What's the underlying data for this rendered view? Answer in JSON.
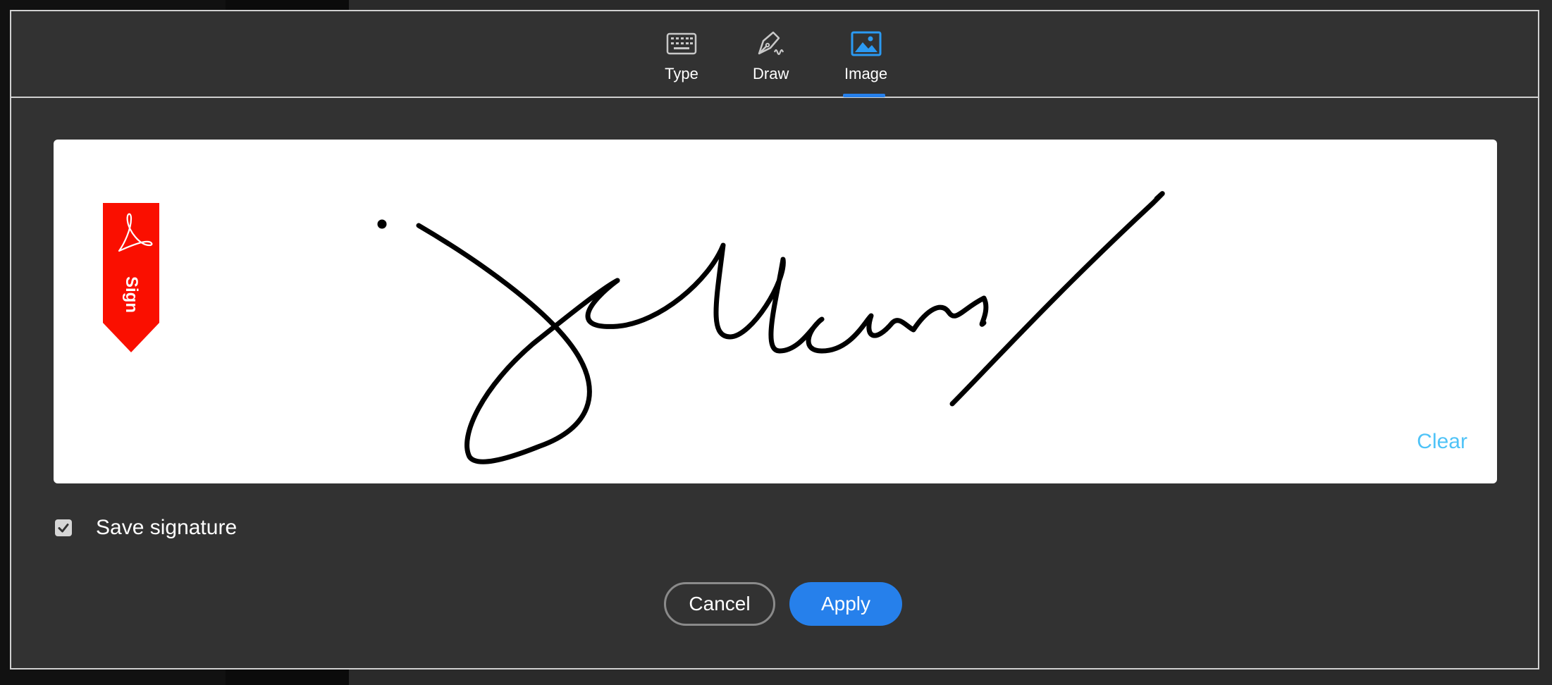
{
  "tabs": [
    {
      "label": "Type",
      "icon": "keyboard-icon",
      "selected": false
    },
    {
      "label": "Draw",
      "icon": "pen-icon",
      "selected": false
    },
    {
      "label": "Image",
      "icon": "image-icon",
      "selected": true
    }
  ],
  "signature_area": {
    "badge_label": "Sign",
    "clear_label": "Clear"
  },
  "save_signature": {
    "label": "Save signature",
    "checked": true
  },
  "buttons": {
    "cancel": "Cancel",
    "apply": "Apply"
  },
  "colors": {
    "accent": "#2680eb",
    "badge": "#fa0f00",
    "link": "#4fc3f7",
    "dialog_bg": "#323232"
  }
}
